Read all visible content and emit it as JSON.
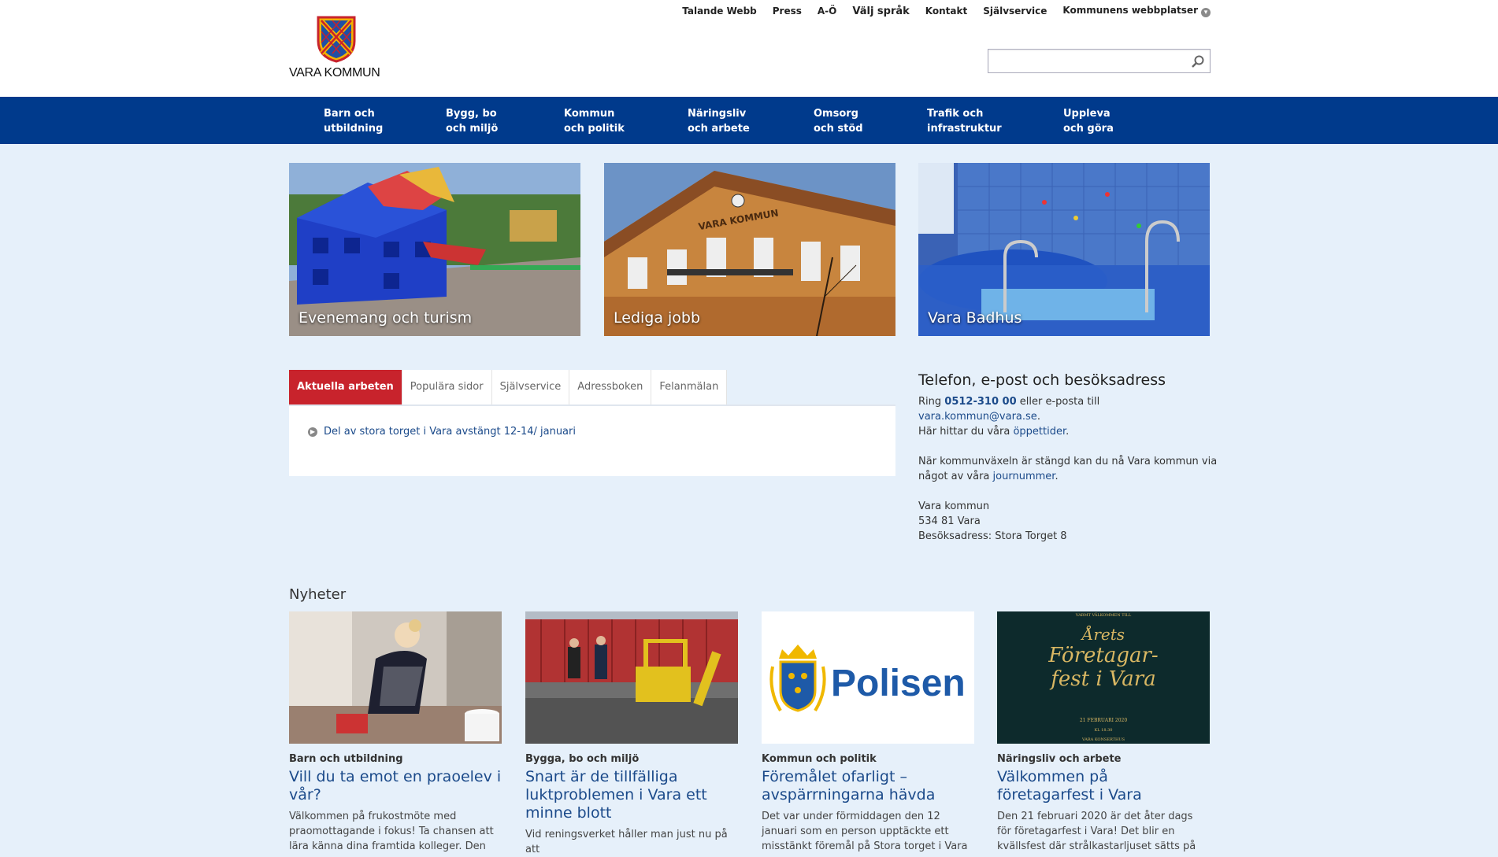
{
  "header": {
    "logo_text": "VARA KOMMUN",
    "toplinks": [
      "Talande Webb",
      "Press",
      "A-Ö",
      "Välj språk",
      "Kontakt",
      "Självservice",
      "Kommunens webbplatser"
    ],
    "search": {
      "placeholder": "",
      "value": ""
    }
  },
  "nav": {
    "items": [
      "Barn och\nutbildning",
      "Bygg, bo\noch miljö",
      "Kommun\noch politik",
      "Näringsliv\noch arbete",
      "Omsorg\noch stöd",
      "Trafik och\ninfrastruktur",
      "Uppleva\noch göra"
    ]
  },
  "hero": [
    {
      "caption": "Evenemang och turism"
    },
    {
      "caption": "Lediga jobb",
      "sign": "VARA KOMMUN"
    },
    {
      "caption": "Vara Badhus"
    }
  ],
  "tabs": {
    "items": [
      "Aktuella arbeten",
      "Populära sidor",
      "Självservice",
      "Adressboken",
      "Felanmälan"
    ],
    "active": 0,
    "link": "Del av stora torget i Vara avstängt 12-14/ januari"
  },
  "contact": {
    "title": "Telefon, e-post och besöksadress",
    "ring_prefix": "Ring ",
    "phone": "0512-310 00",
    "ring_suffix": " eller e-posta till",
    "email": "vara.kommun@vara.se",
    "email_suffix": ".",
    "hours_prefix": "Här hittar du våra ",
    "hours_link": "öppettider",
    "hours_suffix": ".",
    "closed_text": "När kommunväxeln är stängd kan du nå Vara kommun via något av våra ",
    "duty_link": "journummer",
    "duty_suffix": ".",
    "addr1": "Vara kommun",
    "addr2": "534 81 Vara",
    "addr3": "Besöksadress: Stora Torget 8"
  },
  "news": {
    "title": "Nyheter",
    "items": [
      {
        "category": "Barn och utbildning",
        "headline": "Vill du ta emot en praoelev i vår?",
        "excerpt": "Välkommen på frukostmöte med praomottagande i fokus! Ta chansen att lära känna dina framtida kolleger. Den"
      },
      {
        "category": "Bygga, bo och miljö",
        "headline": "Snart är de tillfälliga luktproblemen i Vara ett minne blott",
        "excerpt": "Vid reningsverket håller man just nu på att"
      },
      {
        "category": "Kommun och politik",
        "headline": "Föremålet ofarligt – avspärrningarna hävda",
        "excerpt": "Det var under förmiddagen den 12 januari som en person upptäckte ett misstänkt föremål på Stora torget i Vara",
        "logo_text": "Polisen"
      },
      {
        "category": "Näringsliv och arbete",
        "headline": "Välkommen på företagarfest i Vara",
        "excerpt": "Den 21 februari 2020 är det åter dags för företagarfest i Vara! Det blir en kvällsfest där strålkastarljuset sätts på",
        "poster": {
          "top": "VARMT VÄLKOMMEN TILL",
          "line1": "Årets",
          "line2": "Företagar-",
          "line3": "fest i Vara",
          "date": "21 FEBRUARI 2020",
          "time": "KL 18.30",
          "venue": "VARA KONSERTHUS"
        }
      }
    ]
  },
  "colors": {
    "nav": "#003a8c",
    "tab_active": "#c8232c",
    "link": "#1b4a8a",
    "page_bg": "#e6f0fa"
  }
}
